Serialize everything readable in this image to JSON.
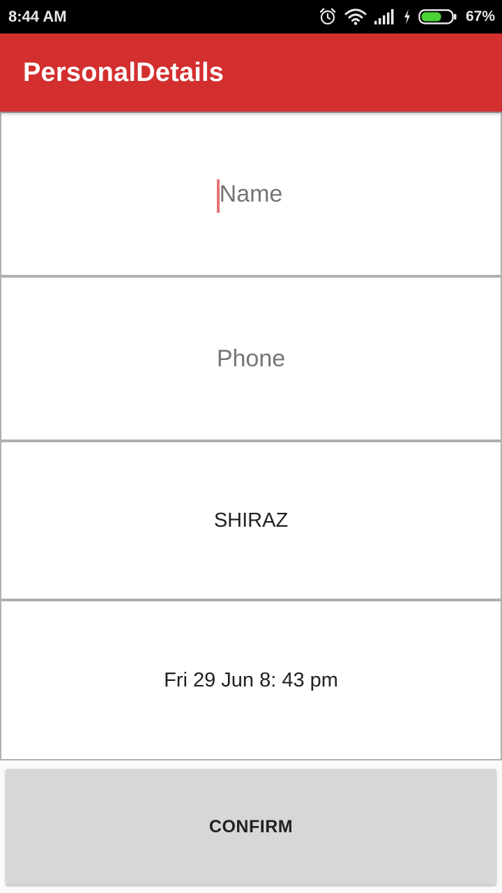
{
  "status_bar": {
    "time": "8:44 AM",
    "battery_percent": "67%",
    "battery_level": 0.67,
    "icons": [
      "alarm-icon",
      "wifi-icon",
      "signal-icon",
      "charging-icon",
      "battery-icon"
    ]
  },
  "app_bar": {
    "title": "PersonalDetails",
    "color": "#d32f2f"
  },
  "form": {
    "name": {
      "value": "",
      "placeholder": "Name"
    },
    "phone": {
      "value": "",
      "placeholder": "Phone"
    },
    "city": {
      "value": "SHIRAZ"
    },
    "datetime": {
      "value": "Fri 29 Jun 8: 43 pm"
    }
  },
  "actions": {
    "confirm_label": "CONFIRM"
  },
  "colors": {
    "accent": "#d32f2f",
    "cursor": "#e57373",
    "button_bg": "#d6d7d7",
    "battery_fill": "#4cd137"
  }
}
